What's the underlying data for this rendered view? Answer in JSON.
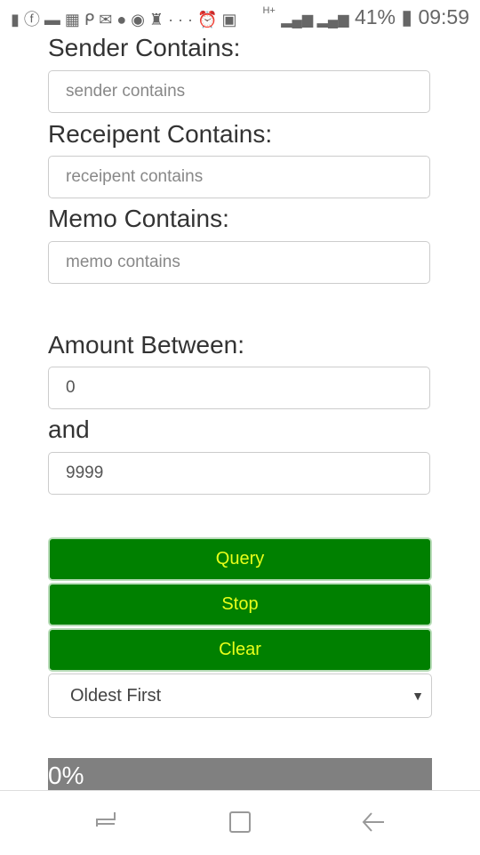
{
  "status_bar": {
    "notification_icons": [
      "alert-icon",
      "facebook-icon",
      "message-icon",
      "grid-icon",
      "p-icon",
      "gmail-icon",
      "circle-icon",
      "record-icon",
      "keyhole-icon",
      "more-icon"
    ],
    "network": "H+",
    "battery": "41%",
    "time": "09:59"
  },
  "form": {
    "sender_label": "Sender Contains:",
    "sender_placeholder": "sender contains",
    "recipient_label": "Receipent Contains:",
    "recipient_placeholder": "receipent contains",
    "memo_label": "Memo Contains:",
    "memo_placeholder": "memo contains",
    "amount_label": "Amount Between:",
    "amount_min": "0",
    "and_label": "and",
    "amount_max": "9999"
  },
  "buttons": {
    "query": "Query",
    "stop": "Stop",
    "clear": "Clear"
  },
  "sort_select": {
    "selected": "Oldest First"
  },
  "progress": {
    "value_percent": 0,
    "label": "0%"
  },
  "colors": {
    "button_bg": "#008000",
    "button_text": "#e8ff1a",
    "progress_bg": "#808080"
  }
}
